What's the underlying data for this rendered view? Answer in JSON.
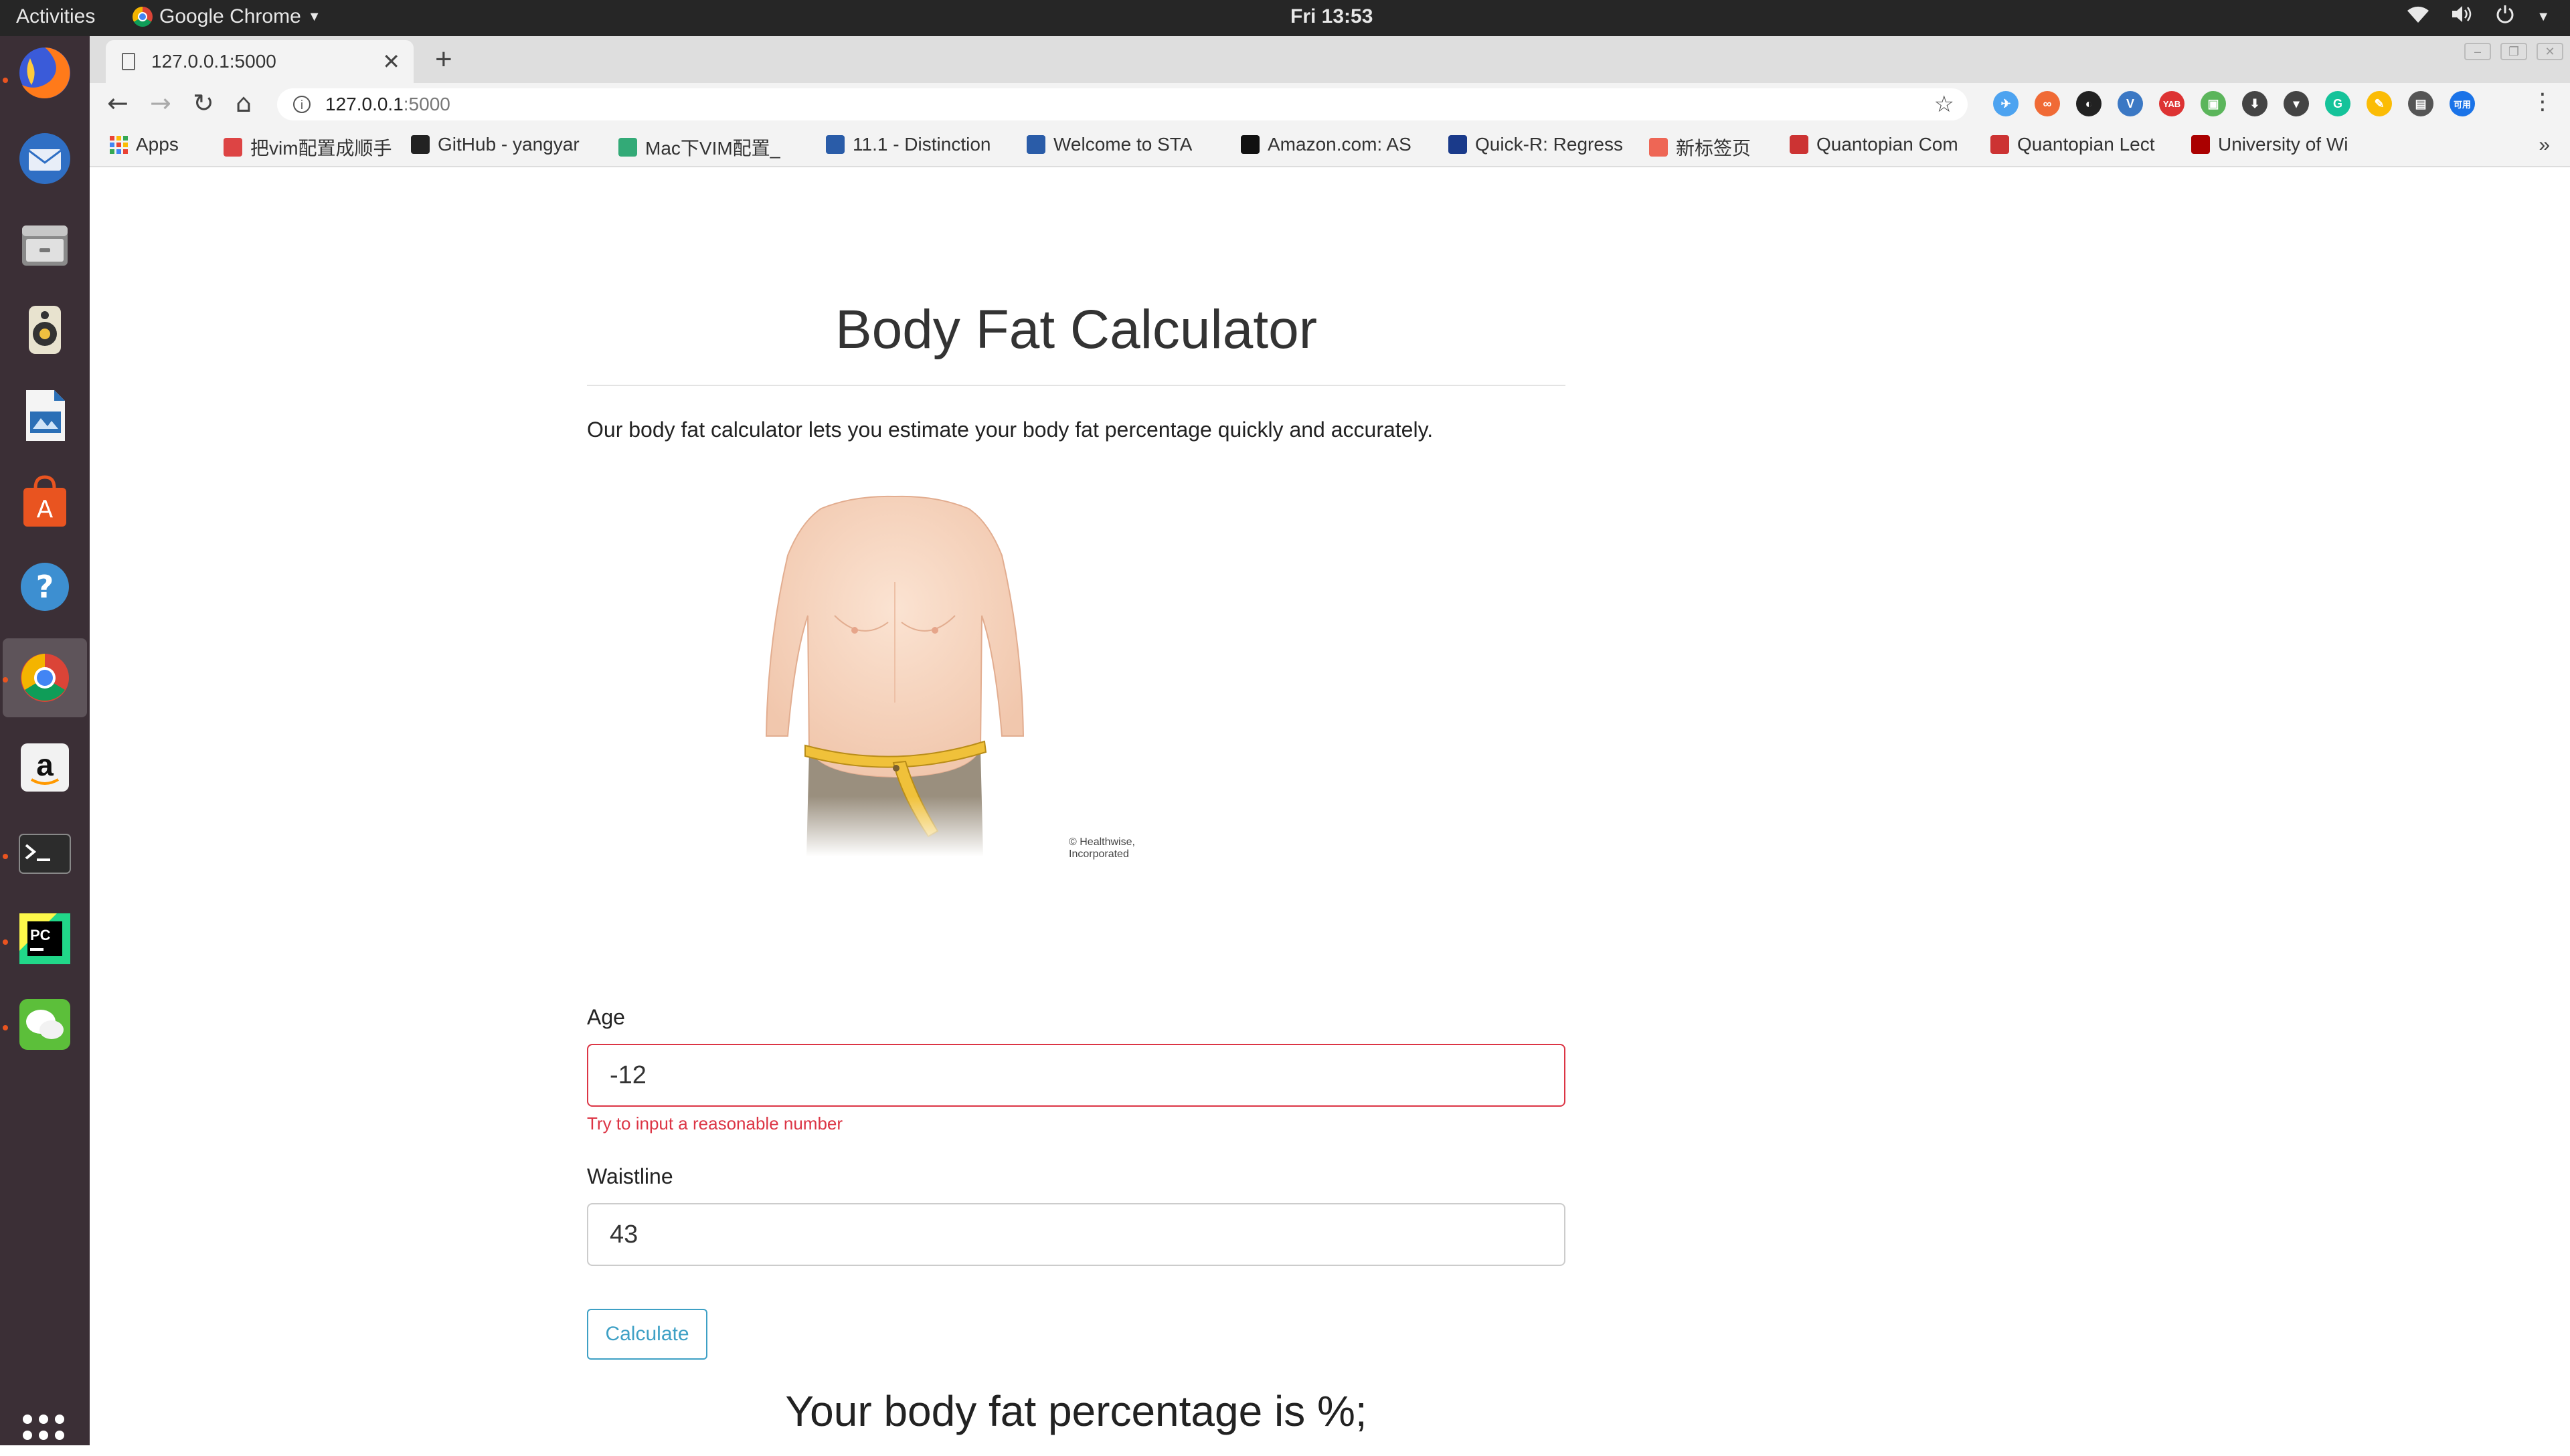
{
  "system_bar": {
    "activities": "Activities",
    "app_name": "Google Chrome",
    "clock": "Fri 13:53"
  },
  "dock": {
    "items": [
      "firefox-icon",
      "thunderbird-icon",
      "files-icon",
      "rhythmbox-icon",
      "libreoffice-impress-icon",
      "ubuntu-software-icon",
      "help-icon",
      "chrome-icon",
      "amazon-icon",
      "terminal-icon",
      "pycharm-icon",
      "wechat-icon"
    ],
    "active": "chrome-icon"
  },
  "browser": {
    "tab_title": "127.0.0.1:5000",
    "url_host": "127.0.0.1",
    "url_port": ":5000",
    "bookmarks": [
      {
        "label": "Apps",
        "icon": "apps-grid-icon"
      },
      {
        "label": "把vim配置成顺手",
        "icon": "bookmark-favicon-red",
        "color": "#d44"
      },
      {
        "label": "GitHub - yangyar",
        "icon": "github-icon",
        "color": "#222"
      },
      {
        "label": "Mac下VIM配置_",
        "icon": "colorful-favicon",
        "color": "#3a7"
      },
      {
        "label": "11.1 - Distinction",
        "icon": "shield-favicon",
        "color": "#2a5ca8"
      },
      {
        "label": "Welcome to STA",
        "icon": "shield-favicon",
        "color": "#2a5ca8"
      },
      {
        "label": "Amazon.com: AS",
        "icon": "amazon-favicon",
        "color": "#111"
      },
      {
        "label": "Quick-R: Regress",
        "icon": "r-favicon",
        "color": "#1a3a8a"
      },
      {
        "label": "新标签页",
        "icon": "infinity-favicon",
        "color": "#e65"
      },
      {
        "label": "Quantopian Com",
        "icon": "quantopian-favicon",
        "color": "#c33"
      },
      {
        "label": "Quantopian Lect",
        "icon": "quantopian-favicon",
        "color": "#c33"
      },
      {
        "label": "University of Wi",
        "icon": "w-favicon",
        "color": "#a00"
      }
    ],
    "extensions": [
      {
        "name": "twitter-ext-icon",
        "color": "#4da3f0",
        "glyph": "✈"
      },
      {
        "name": "infinity-ext-icon",
        "color": "#f06a35",
        "glyph": "∞"
      },
      {
        "name": "dark-reader-ext-icon",
        "color": "#222",
        "glyph": "◐"
      },
      {
        "name": "vue-ext-icon",
        "color": "#3b78c4",
        "glyph": "V"
      },
      {
        "name": "yab-ext-icon",
        "color": "#d33",
        "glyph": "YAB"
      },
      {
        "name": "green-ext-icon",
        "color": "#5bb55b",
        "glyph": "▣"
      },
      {
        "name": "download-ext-icon",
        "color": "#444",
        "glyph": "⬇"
      },
      {
        "name": "pocket-ext-icon",
        "color": "#444",
        "glyph": "▾"
      },
      {
        "name": "grammarly-ext-icon",
        "color": "#15c39a",
        "glyph": "G"
      },
      {
        "name": "ext-icon-multicolor",
        "color": "#fbbc05",
        "glyph": "✎"
      },
      {
        "name": "script-ext-icon",
        "color": "#555",
        "glyph": "▤"
      },
      {
        "name": "profile-ext-icon",
        "color": "#1a73e8",
        "glyph": "可用"
      }
    ]
  },
  "page": {
    "title": "Body Fat Calculator",
    "intro": "Our body fat calculator lets you estimate your body fat percentage quickly and accurately.",
    "image_credit": "© Healthwise, Incorporated",
    "age_label": "Age",
    "age_value": "-12",
    "age_error": "Try to input a reasonable number",
    "waist_label": "Waistline",
    "waist_value": "43",
    "calculate_label": "Calculate",
    "result": "Your body fat percentage is %;"
  }
}
